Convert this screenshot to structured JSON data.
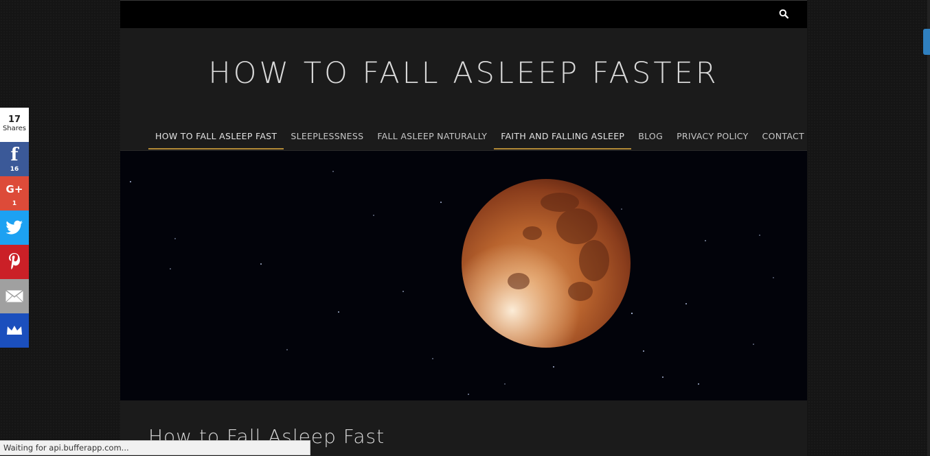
{
  "topbar": {
    "search_icon": "search-icon"
  },
  "site": {
    "title": "HOW TO FALL ASLEEP FASTER"
  },
  "nav": {
    "items": [
      {
        "label": "HOW TO FALL ASLEEP FAST",
        "active": true
      },
      {
        "label": "SLEEPLESSNESS",
        "active": false
      },
      {
        "label": "FALL ASLEEP NATURALLY",
        "active": false
      },
      {
        "label": "FAITH AND FALLING ASLEEP",
        "active": true
      },
      {
        "label": "BLOG",
        "active": false
      },
      {
        "label": "PRIVACY POLICY",
        "active": false
      },
      {
        "label": "CONTACT",
        "active": false
      }
    ]
  },
  "hero": {
    "image": "blood-moon-eclipse"
  },
  "post": {
    "title": "How to Fall Asleep Fast"
  },
  "share": {
    "total": "17",
    "total_label": "Shares",
    "buttons": [
      {
        "network": "facebook",
        "glyph": "f",
        "count": "16",
        "icon": "facebook-icon",
        "color": "#3b5998"
      },
      {
        "network": "google-plus",
        "glyph": "G+",
        "count": "1",
        "icon": "google-plus-icon",
        "color": "#dd4b39"
      },
      {
        "network": "twitter",
        "icon": "twitter-icon",
        "color": "#1da1f2"
      },
      {
        "network": "pinterest",
        "icon": "pinterest-icon",
        "color": "#cb2027"
      },
      {
        "network": "email",
        "icon": "envelope-icon",
        "color": "#a0a0a0"
      },
      {
        "network": "sumome",
        "icon": "crown-icon",
        "color": "#1b4fbd"
      }
    ]
  },
  "status_bar": {
    "text": "Waiting for api.bufferapp.com..."
  },
  "colors": {
    "accent": "#b38a36",
    "page_bg": "#1b1b1b",
    "topbar": "#000000"
  }
}
